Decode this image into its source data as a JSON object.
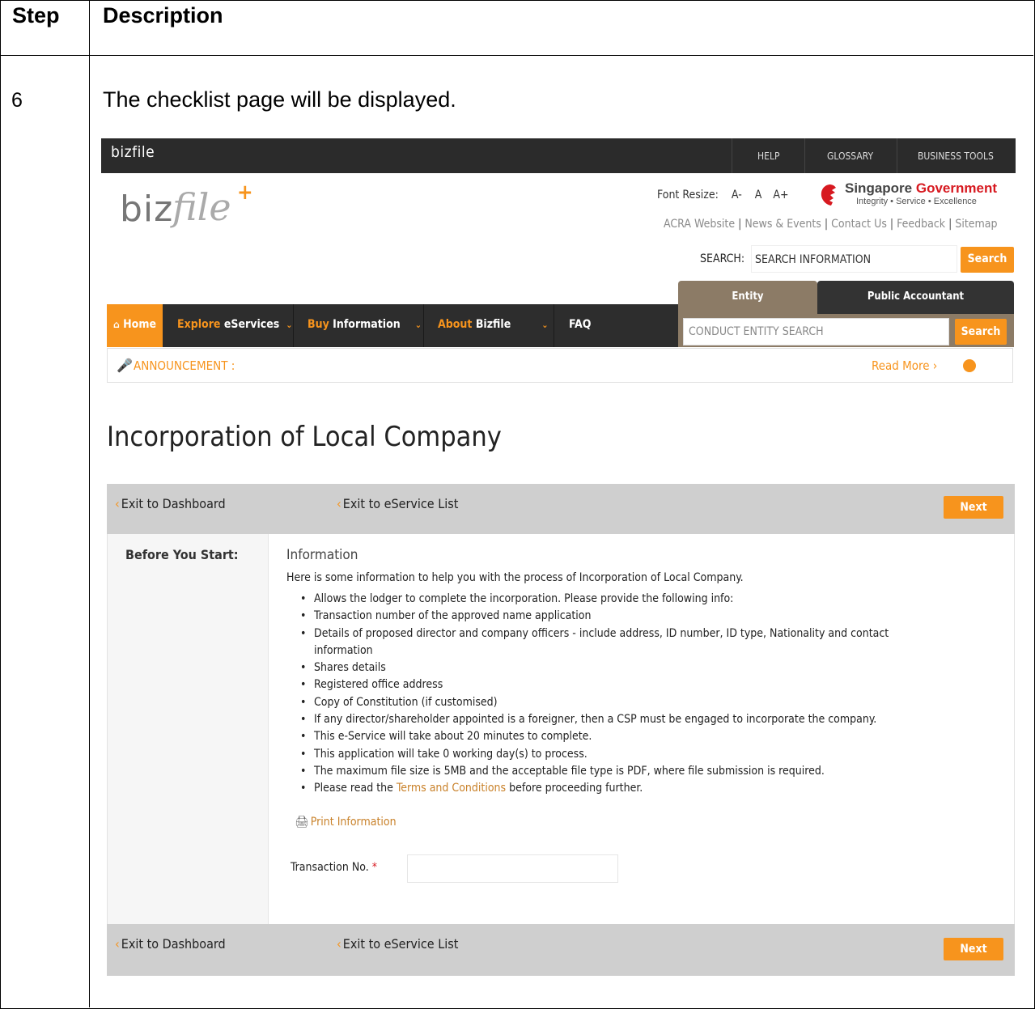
{
  "table": {
    "headers": [
      "Step",
      "Description"
    ],
    "step": "6",
    "description": "The checklist page will be displayed."
  },
  "screenshot": {
    "brand": "bizfile",
    "top_links": [
      "HELP",
      "GLOSSARY",
      "BUSINESS TOOLS"
    ],
    "logo": {
      "biz": "biz",
      "file": "file",
      "plus": "+"
    },
    "font_resize": {
      "label": "Font Resize:",
      "options": [
        "A-",
        "A",
        "A+"
      ]
    },
    "sg_gov": {
      "word1": "Singapore",
      "word2": "Government",
      "tagline": "Integrity • Service • Excellence"
    },
    "header_links": [
      "ACRA Website",
      "News & Events",
      "Contact Us",
      "Feedback",
      "Sitemap"
    ],
    "search": {
      "label": "SEARCH:",
      "value": "SEARCH INFORMATION",
      "button": "Search"
    },
    "tabs": {
      "entity": "Entity",
      "public_accountant": "Public Accountant"
    },
    "entity_search": {
      "placeholder": "CONDUCT ENTITY SEARCH",
      "button": "Search"
    },
    "nav": {
      "home": "Home",
      "explore_a": "Explore",
      "explore_b": "eServices",
      "buy_a": "Buy",
      "buy_b": "Information",
      "about_a": "About",
      "about_b": "Bizfile",
      "faq": "FAQ"
    },
    "announcement": {
      "label": "ANNOUNCEMENT :",
      "read_more": "Read More ›"
    },
    "page_title": "Incorporation of Local Company",
    "actions": {
      "exit_dashboard": "Exit to Dashboard",
      "exit_list": "Exit to eService List",
      "next": "Next"
    },
    "sidebar_title": "Before You Start:",
    "info": {
      "heading": "Information",
      "intro": "Here is some information to help you with the process of Incorporation of Local Company.",
      "bullets": [
        "Allows the lodger to complete the incorporation. Please provide the following info:",
        "Transaction number of the approved name application",
        "Details of proposed director and company officers - include address, ID number, ID type, Nationality and contact information",
        "Shares details",
        "Registered office address",
        "Copy of Constitution (if customised)",
        "If any director/shareholder appointed is a foreigner, then a CSP must be engaged to incorporate the company.",
        "This e-Service will take about 20 minutes to complete.",
        "This application will take 0 working day(s) to process.",
        "The maximum file size is 5MB and the acceptable file type is PDF, where file submission is required."
      ],
      "terms_pre": "Please read the ",
      "terms_link": "Terms and Conditions",
      "terms_post": " before proceeding further.",
      "print": "Print Information"
    },
    "transaction": {
      "label": "Transaction No.",
      "required": "*",
      "value": ""
    }
  }
}
